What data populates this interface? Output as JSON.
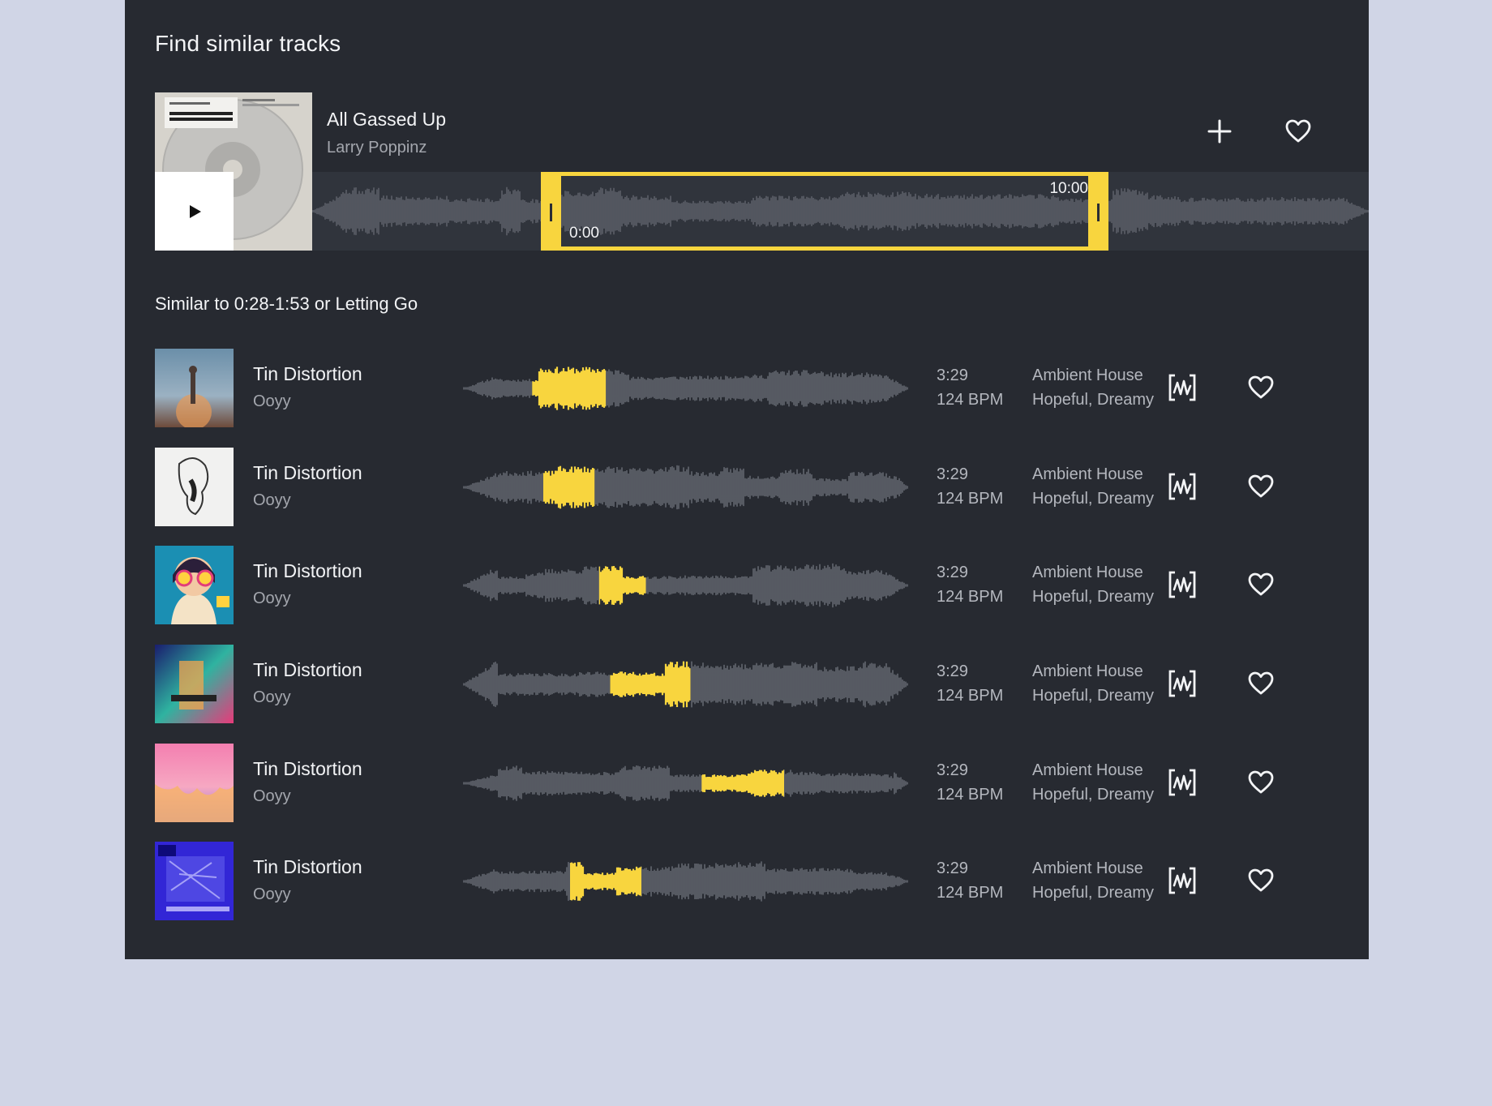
{
  "page": {
    "title": "Find similar tracks"
  },
  "seed": {
    "title": "All Gassed Up",
    "artist": "Larry Poppinz",
    "cover_icon": "cd-cover-art",
    "selection_start": "0:00",
    "selection_end": "10:00",
    "play_icon": "play-icon",
    "add_icon": "plus-icon",
    "like_icon": "heart-icon"
  },
  "subtitle": "Similar to 0:28-1:53 or Letting Go",
  "colors": {
    "background": "#d0d5e6",
    "panel": "#272a31",
    "accent": "#f8d53e",
    "waveform": "#5c5f68",
    "text_primary": "#f3f4f6",
    "text_secondary": "#a4a7ae"
  },
  "tracks": [
    {
      "title": "Tin Distortion",
      "artist": "Ooyy",
      "duration": "3:29",
      "bpm": "124 BPM",
      "genre": "Ambient House",
      "mood": "Hopeful, Dreamy",
      "highlight": [
        0.155,
        0.32
      ],
      "seed": 11,
      "cover": "dusk-figure"
    },
    {
      "title": "Tin Distortion",
      "artist": "Ooyy",
      "duration": "3:29",
      "bpm": "124 BPM",
      "genre": "Ambient House",
      "mood": "Hopeful, Dreamy",
      "highlight": [
        0.18,
        0.295
      ],
      "seed": 23,
      "cover": "sketch"
    },
    {
      "title": "Tin Distortion",
      "artist": "Ooyy",
      "duration": "3:29",
      "bpm": "124 BPM",
      "genre": "Ambient House",
      "mood": "Hopeful, Dreamy",
      "highlight": [
        0.305,
        0.41
      ],
      "seed": 37,
      "cover": "headphones-girl"
    },
    {
      "title": "Tin Distortion",
      "artist": "Ooyy",
      "duration": "3:29",
      "bpm": "124 BPM",
      "genre": "Ambient House",
      "mood": "Hopeful, Dreamy",
      "highlight": [
        0.33,
        0.51
      ],
      "seed": 41,
      "cover": "neon-keyboard"
    },
    {
      "title": "Tin Distortion",
      "artist": "Ooyy",
      "duration": "3:29",
      "bpm": "124 BPM",
      "genre": "Ambient House",
      "mood": "Hopeful, Dreamy",
      "highlight": [
        0.535,
        0.72
      ],
      "seed": 53,
      "cover": "pink-drip"
    },
    {
      "title": "Tin Distortion",
      "artist": "Ooyy",
      "duration": "3:29",
      "bpm": "124 BPM",
      "genre": "Ambient House",
      "mood": "Hopeful, Dreamy",
      "highlight": [
        0.24,
        0.4
      ],
      "seed": 67,
      "cover": "blue-transatlantic"
    }
  ],
  "icons": {
    "similar": "waveform-search-icon",
    "like": "heart-icon"
  }
}
